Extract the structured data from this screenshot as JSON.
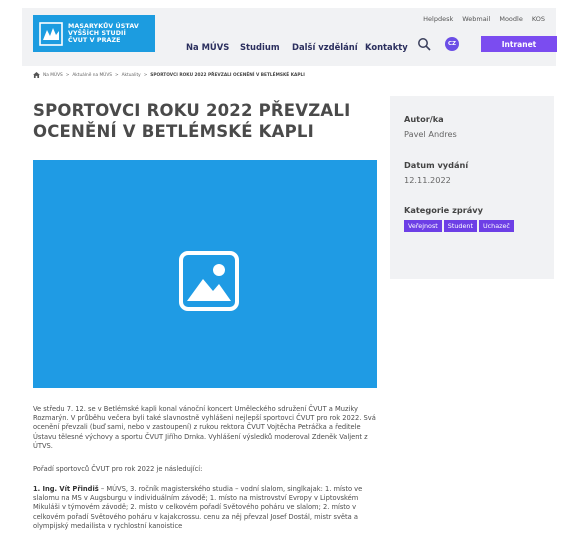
{
  "header": {
    "logo_lines": [
      "MASARYKŮV ÚSTAV",
      "VYŠŠÍCH STUDIÍ",
      "ČVUT V PRAZE"
    ],
    "top_links": [
      "Helpdesk",
      "Webmail",
      "Moodle",
      "KOS"
    ],
    "nav": [
      "Na MÚVS",
      "Studium",
      "Další vzdělání",
      "Kontakty"
    ],
    "lang": "CZ",
    "intranet": "Intranet"
  },
  "breadcrumb": {
    "items": [
      "Na MÚVS",
      "Aktuálně na MÚVS",
      "Aktuality"
    ],
    "current": "SPORTOVCI ROKU 2022 PŘEVZALI OCENĚNÍ V BETLÉMSKÉ KAPLI"
  },
  "article": {
    "title_line1": "SPORTOVCI ROKU 2022 PŘEVZALI",
    "title_line2": "OCENĚNÍ V BETLÉMSKÉ KAPLI",
    "paragraph1": "Ve středu 7. 12. se v Betlémské kapli konal vánoční koncert Uměleckého sdružení ČVUT a Muziky Rozmarýn. V průběhu večera byli také slavnostně vyhlášeni nejlepší sportovci ČVUT pro rok 2022. Svá ocenění převzali (buď sami, nebo v zastoupení) z rukou rektora ČVUT Vojtěcha Petráčka a ředitele Ústavu tělesné výchovy a sportu ČVUT Jiřího Drnka. Vyhlášení výsledků moderoval Zdeněk Valjent z ÚTVS.",
    "paragraph2": "Pořadí sportovců ČVUT pro rok 2022 je následující:",
    "paragraph3_bold": "1. Ing. Vít Přindiš",
    "paragraph3_rest": " – MÚVS, 3. ročník magisterského studia – vodní slalom, singlkajak: 1. místo ve slalomu na MS v Augsburgu v individuálním závodě; 1. místo na mistrovství Evropy v Liptovském Mikuláši v týmovém závodě; 2. místo v celkovém pořadí Světového poháru ve slalom; 2. místo v celkovém pořadí Světového poháru v kajakcrossu. cenu za něj převzal Josef Dostál, mistr světa a olympijský medailista v rychlostní kanoistice"
  },
  "sidebar": {
    "author_label": "Autor/ka",
    "author": "Pavel Andres",
    "date_label": "Datum vydání",
    "date": "12.11.2022",
    "category_label": "Kategorie zprávy",
    "tags": [
      "Veřejnost",
      "Student",
      "Uchazeč"
    ]
  },
  "colors": {
    "brand_blue": "#1c9ce0",
    "accent_purple": "#7b4cf0",
    "panel_gray": "#f1f2f4"
  }
}
